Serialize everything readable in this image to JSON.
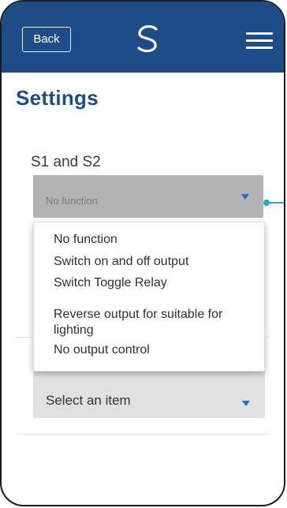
{
  "header": {
    "back_label": "Back",
    "logo_icon": "swirl-s-logo-icon",
    "menu_icon": "hamburger-menu-icon",
    "background": "#1e4c86"
  },
  "page": {
    "title": "Settings"
  },
  "s1_s2": {
    "label": "S1 and S2",
    "selected_value": "No function",
    "options": [
      "No function",
      "Switch on and off output",
      "Switch Toggle Relay",
      "Reverse output for suitable for lighting",
      "No output control"
    ]
  },
  "second_select": {
    "value": "Select an item"
  },
  "colors": {
    "accent": "#1e4c86",
    "caret": "#2c6ad1",
    "callout": "#2ba7c7"
  }
}
